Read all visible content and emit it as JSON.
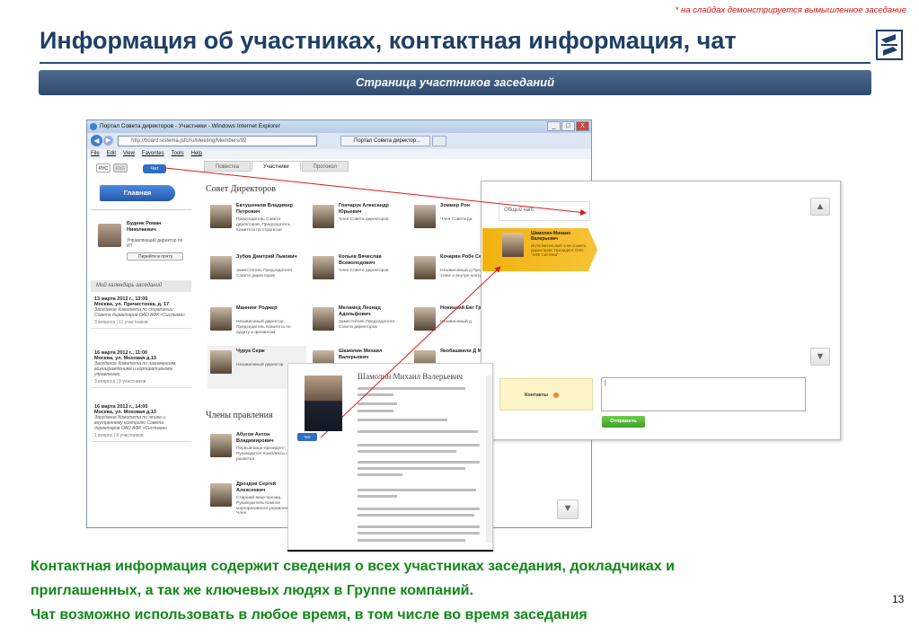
{
  "slide": {
    "note": "* на слайдах демонстрируется вымышленное заседание",
    "title": "Информация об участниках, контактная информация, чат",
    "banner": "Страница участников заседаний",
    "footer_lines": [
      "Контактная информация содержит сведения о всех участниках заседания, докладчиках и",
      "приглашенных, а так же ключевых людях в Группе компаний.",
      "Чат возможно использовать в любое время, в том числе во время заседания"
    ],
    "page_number": "13",
    "colors": {
      "title": "#1f3f66",
      "banner": "#3b5880",
      "footer": "#12881a",
      "note": "#d01010"
    }
  },
  "browser": {
    "title": "Портал Совета директоров - Участники - Windows Internet Explorer",
    "url": "http://board.sistema.jsfc/ru/Meeting/Members/92",
    "tab": "Портал Совета директор...",
    "menu": [
      "File",
      "Edit",
      "View",
      "Favorites",
      "Tools",
      "Help"
    ],
    "controls": [
      "_",
      "□",
      "X"
    ]
  },
  "sidebar": {
    "lang": [
      "РУС",
      "ENG"
    ],
    "chat_button": "Чат",
    "main_button": "Главная",
    "user_name": "Будник Роман Николаевич",
    "user_role": "Управляющий директор по ИТ",
    "mail_button": "Перейти в почту",
    "calendar_title": "Мой календарь заседаний",
    "events": [
      {
        "date": "13 марта 2012 г., 13:00",
        "place": "Москва, ул. Пречистенка, д. 17",
        "title": "Заседание Комитета по стратегии Совета директоров ОАО АФК «Система»",
        "meta": "3 вопроса | 11 участников"
      },
      {
        "date": "16 марта 2012 г., 11:00",
        "place": "Москва, ул. Моховая д.13",
        "title": "Заседание Комитета по назначениям, вознаграждениям и корпоративному управлению.",
        "meta": "3 вопроса | 8 участников"
      },
      {
        "date": "16 марта 2012 г., 14:00",
        "place": "Москва, ул. Моховая д.13",
        "title": "Заседание Комитета по этике и внутреннему контролю Совета директоров ОАО АФК «Система»",
        "meta": "1 вопрос | 9 участников"
      }
    ]
  },
  "main": {
    "tabs": [
      "Повестка",
      "Участники",
      "Протокол"
    ],
    "board_title": "Совет Директоров",
    "board_members": [
      {
        "name": "Евтушенков Владимир Петрович",
        "role": "Председатель Совета директоров; Председатель Комитета по стратегии"
      },
      {
        "name": "Гончарук Александр Юрьевич",
        "role": "Член Совета директоров"
      },
      {
        "name": "Зоммер Рон",
        "role": "Член Совета ди"
      },
      {
        "name": "Зубов Дмитрий Львович",
        "role": "Заместитель Председателя Совета директоров"
      },
      {
        "name": "Копьев Вячеслав Всеволодович",
        "role": "Член Совета директоров"
      },
      {
        "name": "Кочарян Робе Седракович",
        "role": "Независимый д Председатель К этике и внутре контролю"
      },
      {
        "name": "Маннинг Роджер",
        "role": "Независимый директор, Председатель Комитета по аудиту и финансам"
      },
      {
        "name": "Меламед Леонид Адольфович",
        "role": "Заместитель Председателя Совета директоров"
      },
      {
        "name": "Новицкий Евг Григорьевич",
        "role": "Независимый д"
      },
      {
        "name": "Чурук Серж",
        "role": "Независимый директор"
      },
      {
        "name": "Шамолин Михаил Валерьевич",
        "role": ""
      },
      {
        "name": "Якобашвили Д Михайлович",
        "role": ""
      }
    ],
    "management_title": "Члены правления",
    "management": [
      {
        "name": "Абугов Антон Владимирович",
        "role": "Первый вице-президент; Руководител Комплекса стратеги развития."
      },
      {
        "name": "Дроздов Сергей Алексеевич",
        "role": "Старший вице-презид Руководитель Компле корпоративного управления. Член"
      }
    ]
  },
  "chat": {
    "general_chat": "Общий чат",
    "selected": {
      "name": "Шамолин Михаил Валерьевич",
      "role": "Исполнительный член Совета директоров; Президент ОАО \"АФК Система\""
    },
    "contacts_label": "Контакты",
    "message_placeholder": "|",
    "send_button": "Отправить",
    "scroll_up": "▲",
    "scroll_down": "▼"
  },
  "card": {
    "name": "Шамолин Михаил Валерьевич",
    "chat_button": "Чат"
  }
}
